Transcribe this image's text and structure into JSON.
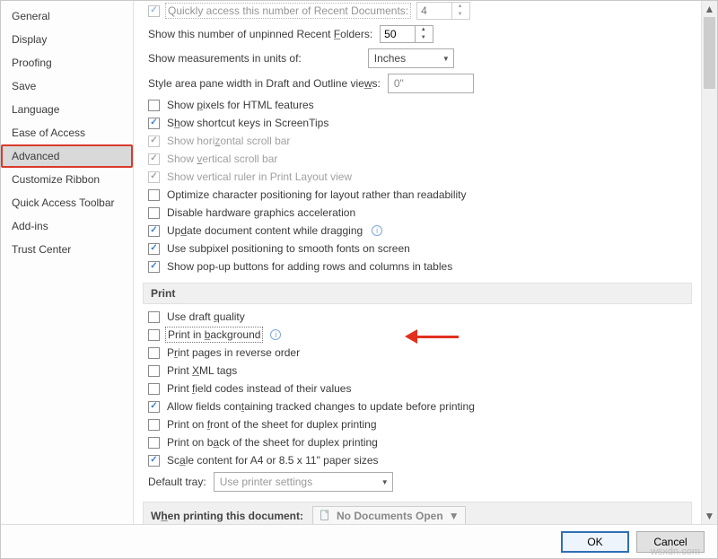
{
  "sidebar": {
    "items": [
      {
        "label": "General"
      },
      {
        "label": "Display"
      },
      {
        "label": "Proofing"
      },
      {
        "label": "Save"
      },
      {
        "label": "Language"
      },
      {
        "label": "Ease of Access"
      },
      {
        "label": "Advanced"
      },
      {
        "label": "Customize Ribbon"
      },
      {
        "label": "Quick Access Toolbar"
      },
      {
        "label": "Add-ins"
      },
      {
        "label": "Trust Center"
      }
    ],
    "selected_index": 6
  },
  "display_section": {
    "recent_docs_label": "Quickly access this number of Recent Documents:",
    "recent_docs_value": "4",
    "unpinned_folders_label": "Show this number of unpinned Recent Folders:",
    "unpinned_folders_value": "50",
    "measurements_label": "Show measurements in units of:",
    "measurements_value": "Inches",
    "style_area_label": "Style area pane width in Draft and Outline views:",
    "style_area_value": "0\"",
    "options": [
      {
        "label": "Show pixels for HTML features",
        "checked": false,
        "disabled": false,
        "u": "p"
      },
      {
        "label": "Show shortcut keys in ScreenTips",
        "checked": true,
        "disabled": false,
        "u": "h"
      },
      {
        "label": "Show horizontal scroll bar",
        "checked": true,
        "disabled": true,
        "u": "z"
      },
      {
        "label": "Show vertical scroll bar",
        "checked": true,
        "disabled": true,
        "u": "v"
      },
      {
        "label": "Show vertical ruler in Print Layout view",
        "checked": true,
        "disabled": true,
        "u": null
      },
      {
        "label": "Optimize character positioning for layout rather than readability",
        "checked": false,
        "disabled": false,
        "u": null
      },
      {
        "label": "Disable hardware graphics acceleration",
        "checked": false,
        "disabled": false,
        "u": null
      },
      {
        "label": "Update document content while dragging",
        "checked": true,
        "disabled": false,
        "u": "d",
        "info": true
      },
      {
        "label": "Use subpixel positioning to smooth fonts on screen",
        "checked": true,
        "disabled": false,
        "u": null
      },
      {
        "label": "Show pop-up buttons for adding rows and columns in tables",
        "checked": true,
        "disabled": false,
        "u": null
      }
    ]
  },
  "print_section": {
    "heading": "Print",
    "options": [
      {
        "label": "Use draft quality",
        "checked": false,
        "u": "q"
      },
      {
        "label": "Print in background",
        "checked": false,
        "u": "b",
        "focus": true,
        "info": true
      },
      {
        "label": "Print pages in reverse order",
        "checked": false,
        "u": "r"
      },
      {
        "label": "Print XML tags",
        "checked": false,
        "u": "X"
      },
      {
        "label": "Print field codes instead of their values",
        "checked": false,
        "u": "f"
      },
      {
        "label": "Allow fields containing tracked changes to update before printing",
        "checked": true,
        "u": "t"
      },
      {
        "label": "Print on front of the sheet for duplex printing",
        "checked": false,
        "u": "f"
      },
      {
        "label": "Print on back of the sheet for duplex printing",
        "checked": false,
        "u": "a"
      },
      {
        "label": "Scale content for A4 or 8.5 x 11\" paper sizes",
        "checked": true,
        "u": "A"
      }
    ],
    "tray_label": "Default tray:",
    "tray_value": "Use printer settings"
  },
  "doc_section": {
    "heading": "When printing this document:",
    "combo_value": "No Documents Open"
  },
  "footer": {
    "ok": "OK",
    "cancel": "Cancel"
  },
  "watermark": "wsxdn.com"
}
